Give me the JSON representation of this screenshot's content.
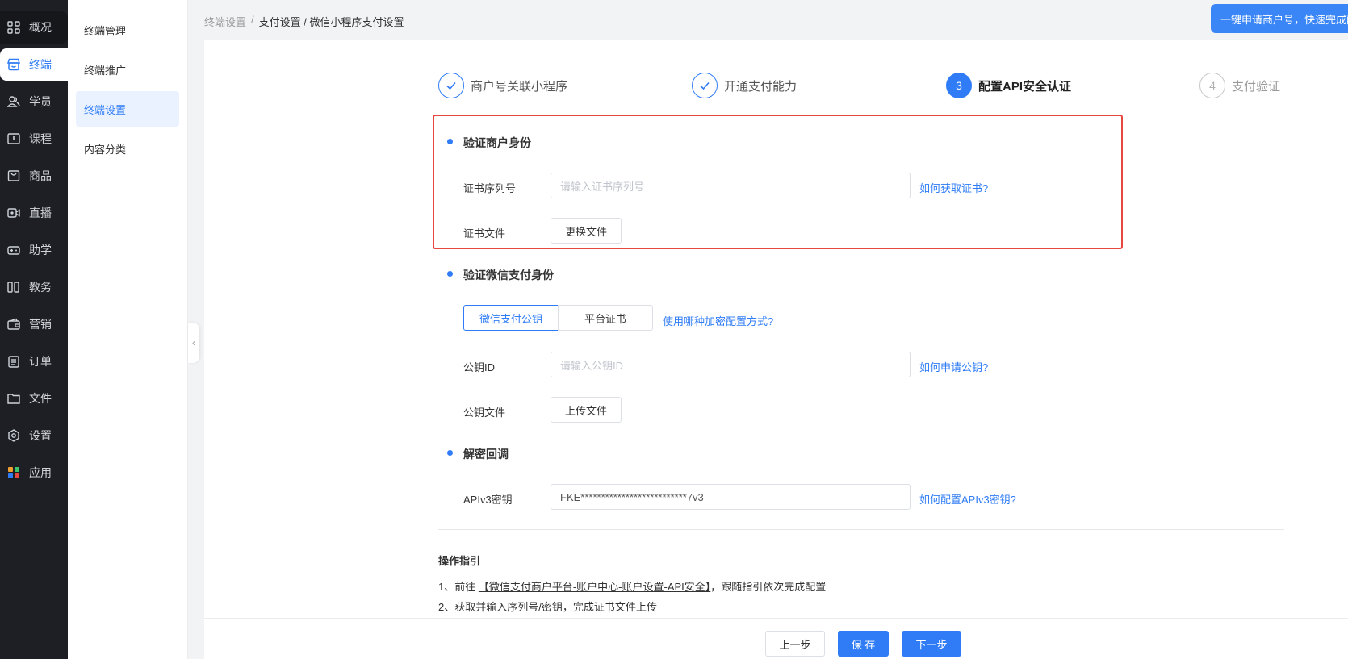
{
  "nav": {
    "items": [
      {
        "label": "概况",
        "icon": "grid-icon"
      },
      {
        "label": "终端",
        "icon": "store-icon"
      },
      {
        "label": "学员",
        "icon": "users-icon"
      },
      {
        "label": "课程",
        "icon": "course-icon"
      },
      {
        "label": "商品",
        "icon": "bag-icon"
      },
      {
        "label": "直播",
        "icon": "video-icon"
      },
      {
        "label": "助学",
        "icon": "gamepad-icon"
      },
      {
        "label": "教务",
        "icon": "book-icon"
      },
      {
        "label": "营销",
        "icon": "wallet-icon"
      },
      {
        "label": "订单",
        "icon": "clipboard-icon"
      },
      {
        "label": "文件",
        "icon": "folder-icon"
      },
      {
        "label": "设置",
        "icon": "gear-icon"
      },
      {
        "label": "应用",
        "icon": "apps-icon"
      }
    ]
  },
  "subnav": {
    "items": [
      "终端管理",
      "终端推广",
      "终端设置",
      "内容分类"
    ]
  },
  "breadcrumb": {
    "items": [
      "终端设置",
      "/",
      "支付设置 / 微信小程序支付设置"
    ]
  },
  "top_button": "一键申请商户号，快速完成配置",
  "steps": [
    {
      "index": "1",
      "label": "商户号关联小程序",
      "status": "done"
    },
    {
      "index": "2",
      "label": "开通支付能力",
      "status": "done"
    },
    {
      "index": "3",
      "label": "配置API安全认证",
      "status": "current"
    },
    {
      "index": "4",
      "label": "支付验证",
      "status": "todo"
    }
  ],
  "section1": {
    "title": "验证商户身份",
    "serial_label": "证书序列号",
    "serial_placeholder": "请输入证书序列号",
    "serial_link": "如何获取证书?",
    "file_label": "证书文件",
    "file_button": "更换文件"
  },
  "section2": {
    "title": "验证微信支付身份",
    "seg_a": "微信支付公钥",
    "seg_b": "平台证书",
    "seg_link": "使用哪种加密配置方式?",
    "id_label": "公钥ID",
    "id_placeholder": "请输入公钥ID",
    "id_link": "如何申请公钥?",
    "file_label": "公钥文件",
    "file_button": "上传文件"
  },
  "section3": {
    "title": "解密回调",
    "key_label": "APIv3密钥",
    "key_value": "FKE**************************7v3",
    "key_link": "如何配置APIv3密钥?"
  },
  "guide": {
    "title": "操作指引",
    "line1_prefix": "1、前往 ",
    "line1_link": "【微信支付商户平台-账户中心-账户设置-API安全】",
    "line1_suffix": "，跟随指引依次完成配置",
    "line2": "2、获取并输入序列号/密钥，完成证书文件上传"
  },
  "footer": {
    "prev": "上一步",
    "save": "保 存",
    "next": "下一步"
  },
  "colors": {
    "primary": "#2f7cf6",
    "highlight": "#e5483f",
    "nav_bg": "#1d1f24"
  }
}
